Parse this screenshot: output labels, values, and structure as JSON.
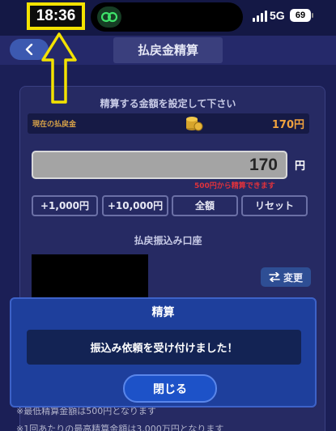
{
  "status_bar": {
    "time": "18:36",
    "network": "5G",
    "battery": "69"
  },
  "header": {
    "title": "払戻金精算"
  },
  "settle": {
    "section_title": "精算する金額を設定して下さい",
    "balance_label": "現在の払戻金",
    "balance_value": "170円",
    "amount_value": "170",
    "amount_unit": "円",
    "min_note": "500円から精算できます",
    "quick_buttons": [
      "+1,000円",
      "+10,000円",
      "全額",
      "リセット"
    ]
  },
  "account": {
    "section_title": "払戻振込み口座",
    "change_label": "変更"
  },
  "notes": [
    "※最低精算金額は500円となります",
    "※1回あたりの最高精算金額は3,000万円となります"
  ],
  "modal": {
    "title": "精算",
    "message": "振込み依頼を受け付けました！",
    "close_label": "閉じる"
  },
  "colors": {
    "highlight_yellow": "#f3e200",
    "background": "#1b1f56",
    "modal": "#1e3f9c",
    "balance_orange": "#f0a23e",
    "note_red": "#e0323c"
  },
  "icons": {
    "back": "chevron-left-icon",
    "link": "link-icon",
    "coin": "coin-stack-icon",
    "change": "swap-arrows-icon"
  }
}
